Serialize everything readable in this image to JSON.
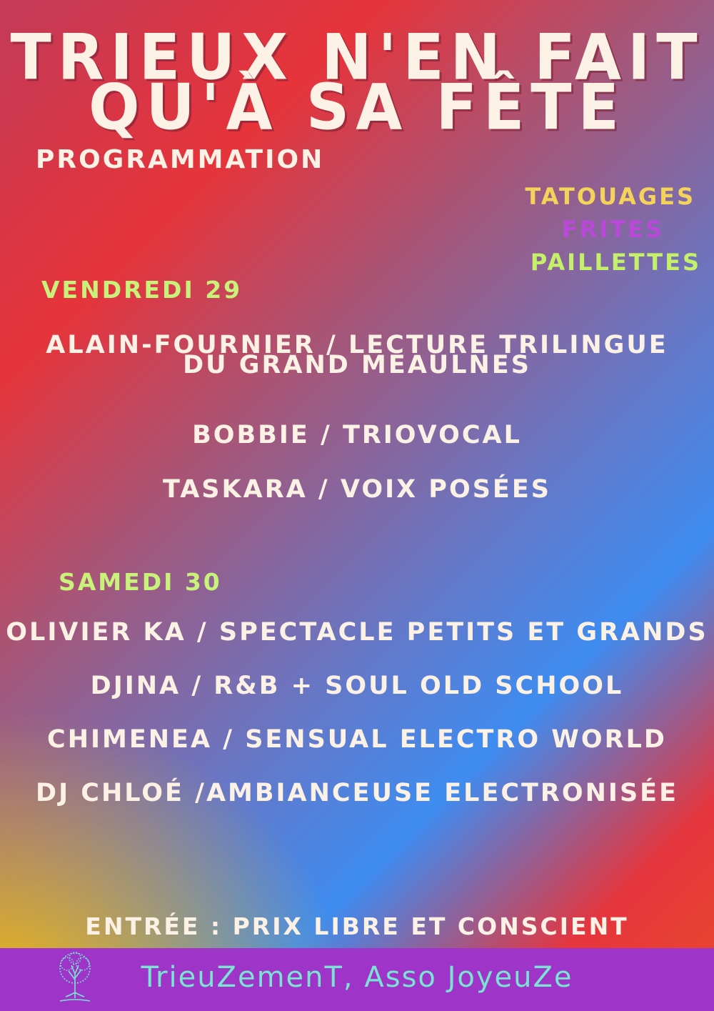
{
  "poster": {
    "title_line1": "TRIEUX N'EN FAIT",
    "title_line2": "QU'À SA FÊTE",
    "section_label": "PROGRAMMATION",
    "extras": [
      "TATOUAGES",
      "FRITES",
      "PAILLETTES"
    ],
    "days": [
      {
        "label": "VENDREDI 29",
        "acts": [
          "ALAIN-FOURNIER / LECTURE TRILINGUE",
          "DU GRAND MEAULNES",
          "BOBBIE / TRIOVOCAL",
          "TASKARA / VOIX POSÉES"
        ]
      },
      {
        "label": "SAMEDI 30",
        "acts": [
          "OLIVIER KA / SPECTACLE PETITS ET GRANDS",
          "DJINA / R&B + SOUL OLD SCHOOL",
          "CHIMENEA / SENSUAL ELECTRO WORLD",
          "DJ CHLOÉ /AMBIANCEUSE ELECTRONISÉE"
        ]
      }
    ],
    "entry": "ENTRÉE : PRIX LIBRE ET CONSCIENT",
    "organizer": "TrieuZemenT, Asso JoyeuZe",
    "logo_icon": "tree-logo-icon",
    "colors": {
      "title": "#fbf1e4",
      "day_label": "#c8f27a",
      "tatouages": "#f4d35a",
      "frites": "#b94ad8",
      "paillettes": "#c4f06a",
      "band_bg": "#9e34c8",
      "band_text": "#7ae3d2"
    }
  }
}
